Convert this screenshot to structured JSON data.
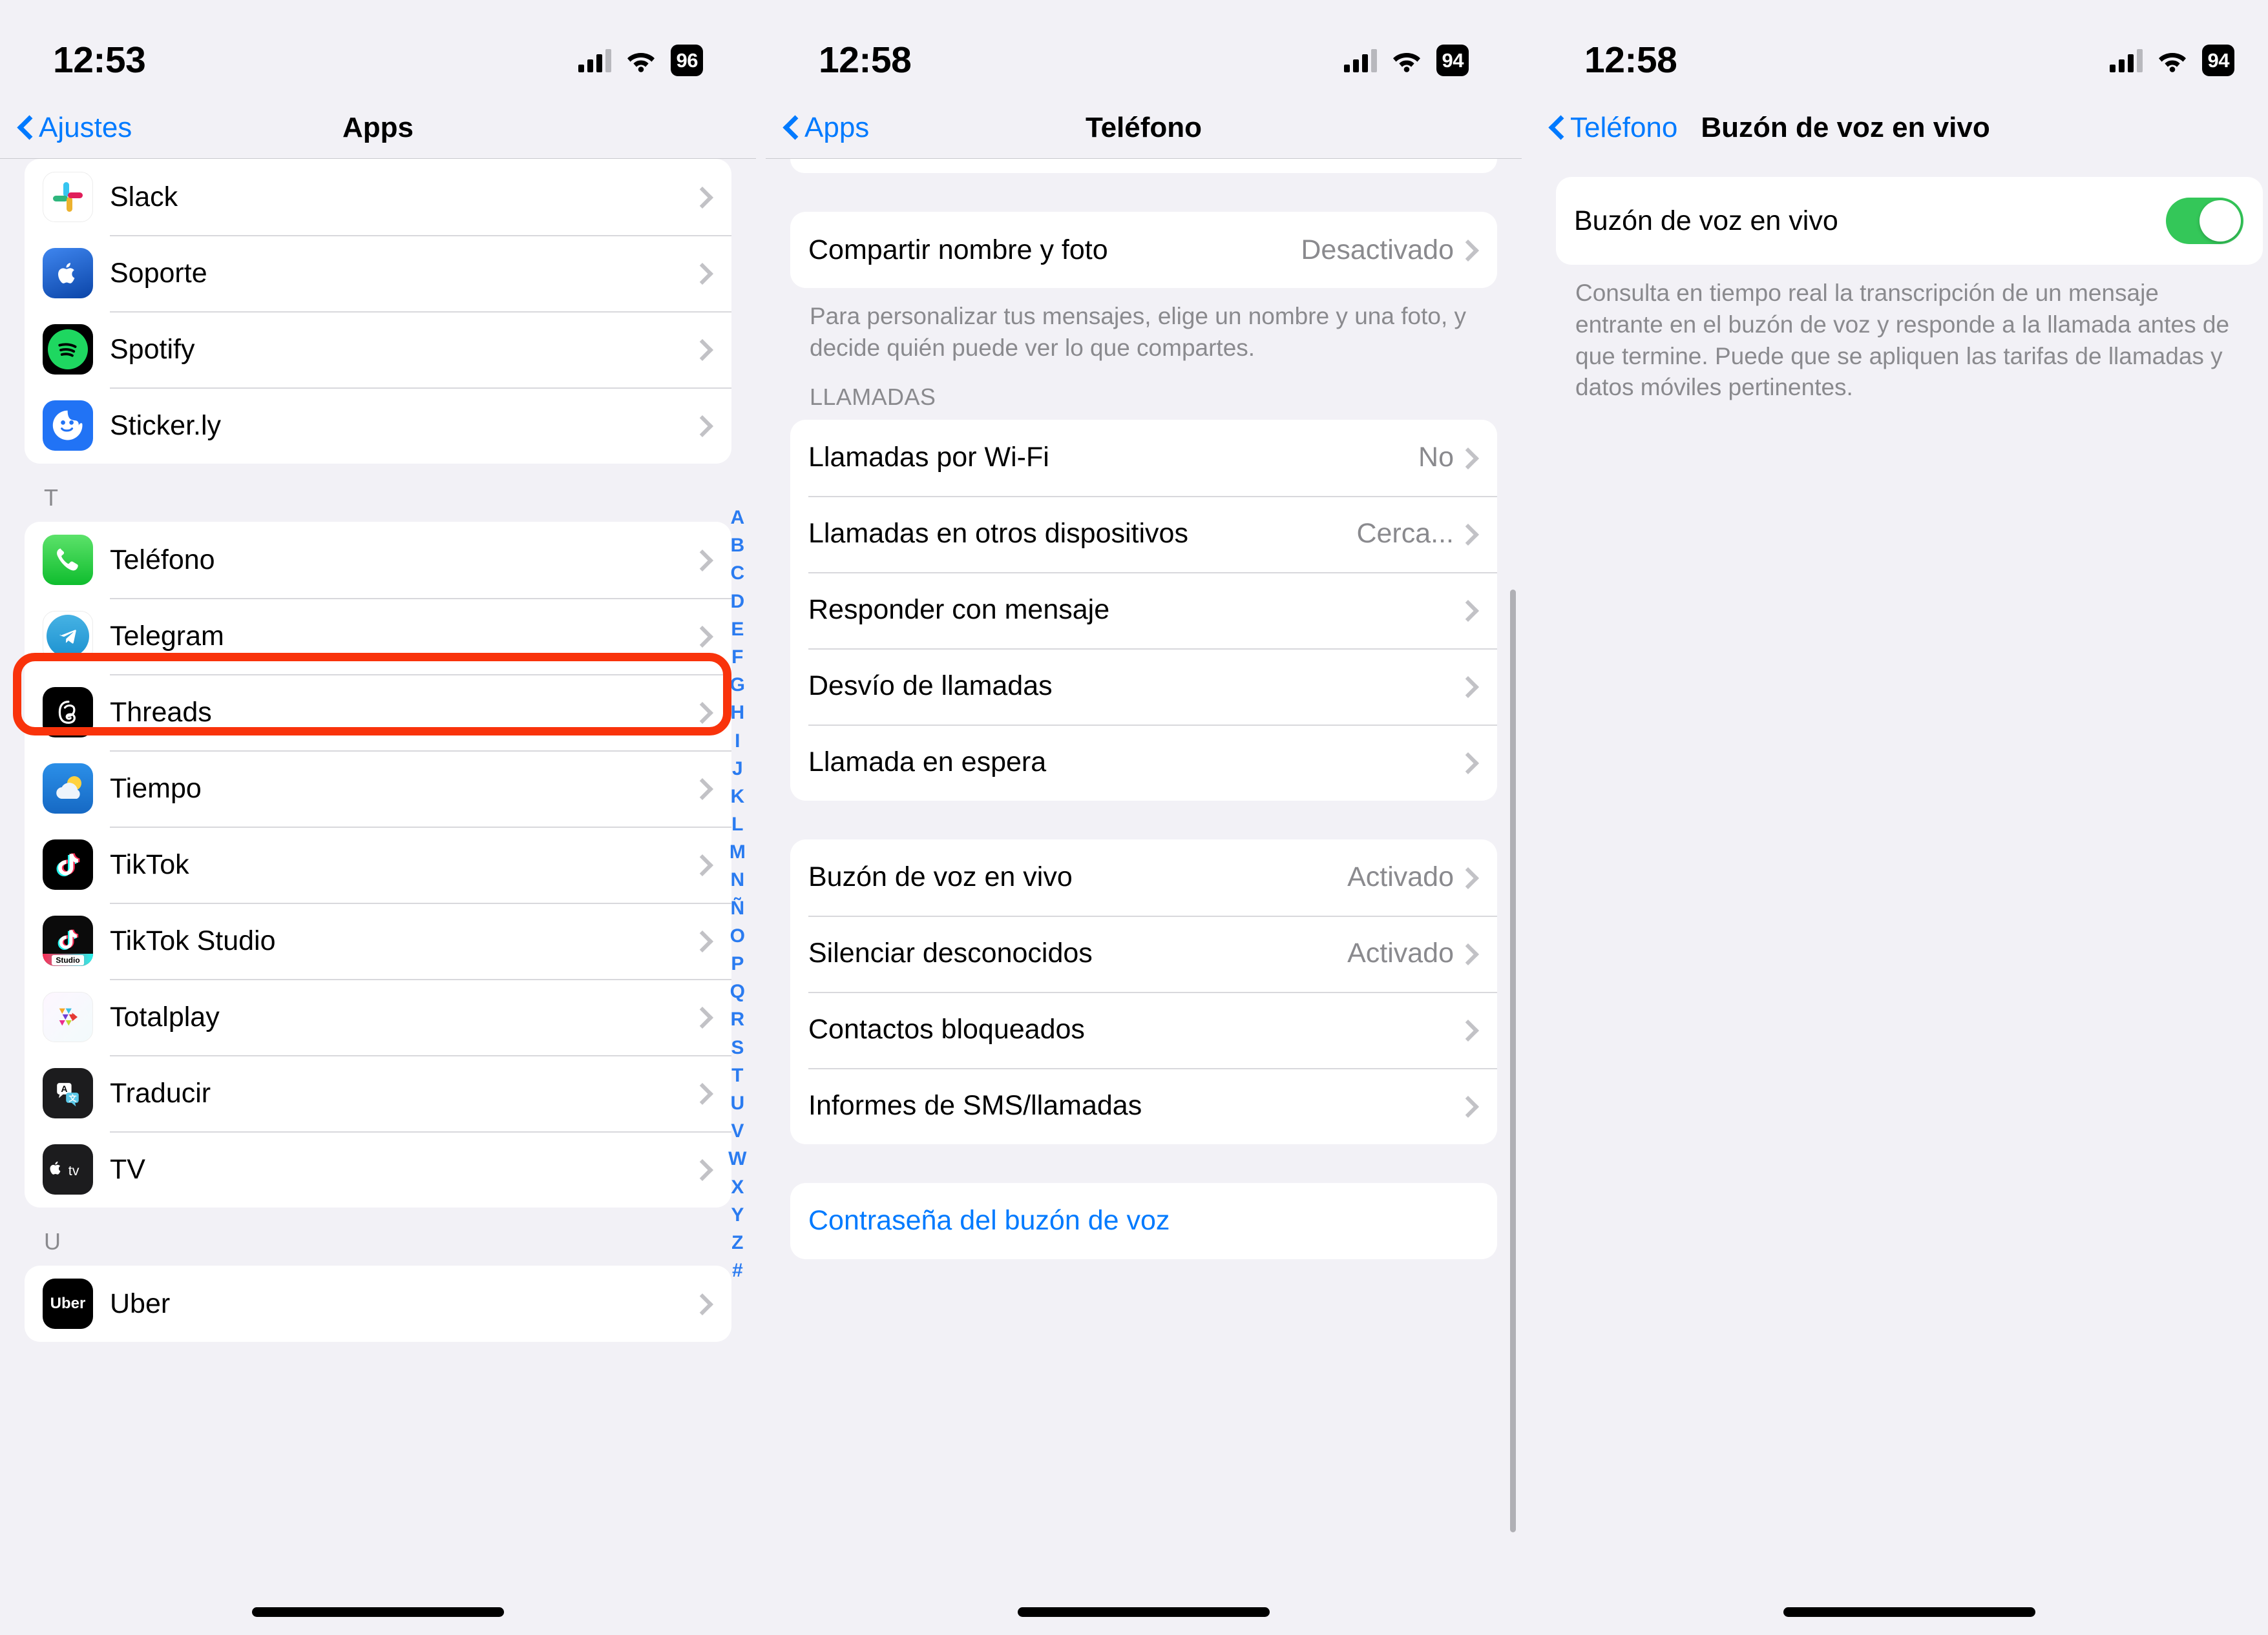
{
  "panels": [
    {
      "id": "apps-list",
      "status": {
        "time": "12:53",
        "battery": "96",
        "signal_icon": "cellular-bars-icon",
        "wifi_icon": "wifi-icon",
        "battery_icon": "battery-badge"
      },
      "nav": {
        "back_label": "Ajustes",
        "title": "Apps"
      },
      "groups": [
        {
          "letter": "",
          "items": [
            {
              "label": "Slack",
              "icon": "slack-icon"
            },
            {
              "label": "Soporte",
              "icon": "apple-support-icon"
            },
            {
              "label": "Spotify",
              "icon": "spotify-icon"
            },
            {
              "label": "Sticker.ly",
              "icon": "stickerly-icon"
            }
          ]
        },
        {
          "letter": "T",
          "items": [
            {
              "label": "Teléfono",
              "icon": "phone-icon",
              "highlighted": true
            },
            {
              "label": "Telegram",
              "icon": "telegram-icon"
            },
            {
              "label": "Threads",
              "icon": "threads-icon"
            },
            {
              "label": "Tiempo",
              "icon": "weather-icon"
            },
            {
              "label": "TikTok",
              "icon": "tiktok-icon"
            },
            {
              "label": "TikTok Studio",
              "icon": "tiktok-studio-icon"
            },
            {
              "label": "Totalplay",
              "icon": "totalplay-icon"
            },
            {
              "label": "Traducir",
              "icon": "translate-icon"
            },
            {
              "label": "TV",
              "icon": "apple-tv-icon"
            }
          ]
        },
        {
          "letter": "U",
          "items": [
            {
              "label": "Uber",
              "icon": "uber-icon"
            }
          ]
        }
      ],
      "alphabet_index": [
        "A",
        "B",
        "C",
        "D",
        "E",
        "F",
        "G",
        "H",
        "I",
        "J",
        "K",
        "L",
        "M",
        "N",
        "Ñ",
        "O",
        "P",
        "Q",
        "R",
        "S",
        "T",
        "U",
        "V",
        "W",
        "X",
        "Y",
        "Z",
        "#"
      ]
    },
    {
      "id": "telefono-settings",
      "status": {
        "time": "12:58",
        "battery": "94",
        "signal_icon": "cellular-bars-icon",
        "wifi_icon": "wifi-icon",
        "battery_icon": "battery-badge"
      },
      "nav": {
        "back_label": "Apps",
        "title": "Teléfono"
      },
      "share_row": {
        "label": "Compartir nombre y foto",
        "value": "Desactivado"
      },
      "share_footnote": "Para personalizar tus mensajes, elige un nombre y una foto, y decide quién puede ver lo que compartes.",
      "calls_header": "LLAMADAS",
      "calls_rows": [
        {
          "label": "Llamadas por Wi-Fi",
          "value": "No"
        },
        {
          "label": "Llamadas en otros dispositivos",
          "value": "Cerca..."
        },
        {
          "label": "Responder con mensaje",
          "value": ""
        },
        {
          "label": "Desvío de llamadas",
          "value": ""
        },
        {
          "label": "Llamada en espera",
          "value": ""
        }
      ],
      "privacy_rows": [
        {
          "label": "Buzón de voz en vivo",
          "value": "Activado",
          "highlighted": true
        },
        {
          "label": "Silenciar desconocidos",
          "value": "Activado"
        },
        {
          "label": "Contactos bloqueados",
          "value": ""
        },
        {
          "label": "Informes de SMS/llamadas",
          "value": ""
        }
      ],
      "password_row": {
        "label": "Contraseña del buzón de voz"
      }
    },
    {
      "id": "live-voicemail",
      "status": {
        "time": "12:58",
        "battery": "94",
        "signal_icon": "cellular-bars-icon",
        "wifi_icon": "wifi-icon",
        "battery_icon": "battery-badge"
      },
      "nav": {
        "back_label": "Teléfono",
        "title": "Buzón de voz en vivo"
      },
      "toggle_row": {
        "label": "Buzón de voz en vivo",
        "state": "on"
      },
      "footnote": "Consulta en tiempo real la transcripción de un mensaje entrante en el buzón de voz y responde a la llamada antes de que termine. Puede que se apliquen las tarifas de llamadas y datos móviles pertinentes."
    }
  ],
  "colors": {
    "accent_blue": "#007aff",
    "highlight_red": "#f9330b",
    "toggle_green": "#34c759",
    "page_bg": "#f2f1f6",
    "card_bg": "#ffffff",
    "secondary_text": "#8a8a8e"
  }
}
